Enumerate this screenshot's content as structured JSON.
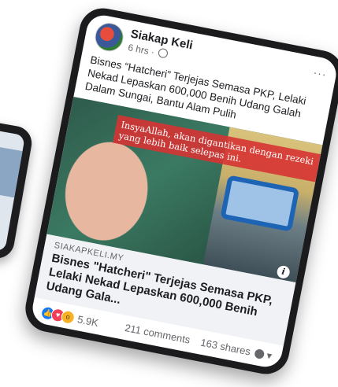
{
  "post": {
    "page_name": "Siakap Keli",
    "time": "6 hrs ·",
    "more": "···",
    "text": "Bisnes “Hatcheri” Terjejas Semasa PKP, Lelaki Nekad Lepaskan 600,000 Benih Udang Galah Dalam Sungai, Bantu Alam Pulih",
    "image_caption": "InsyaAllah, akan digantikan dengan rezeki yang lebih baik selepas ini.",
    "link": {
      "domain": "SIAKAPKELI.MY",
      "title": "Bisnes \"Hatcheri\" Terjejas Semasa PKP, Lelaki Nekad Lepaskan 600,000 Benih Udang Gala...",
      "info": "i"
    },
    "reactions": {
      "count": "5.9K",
      "types": [
        "like-icon",
        "love-icon",
        "wow-icon"
      ]
    },
    "comments": "211 comments",
    "shares": "163 shares"
  },
  "colors": {
    "banner": "#d63333",
    "like": "#1877f2",
    "love": "#f33e58",
    "wow": "#f7b125"
  }
}
